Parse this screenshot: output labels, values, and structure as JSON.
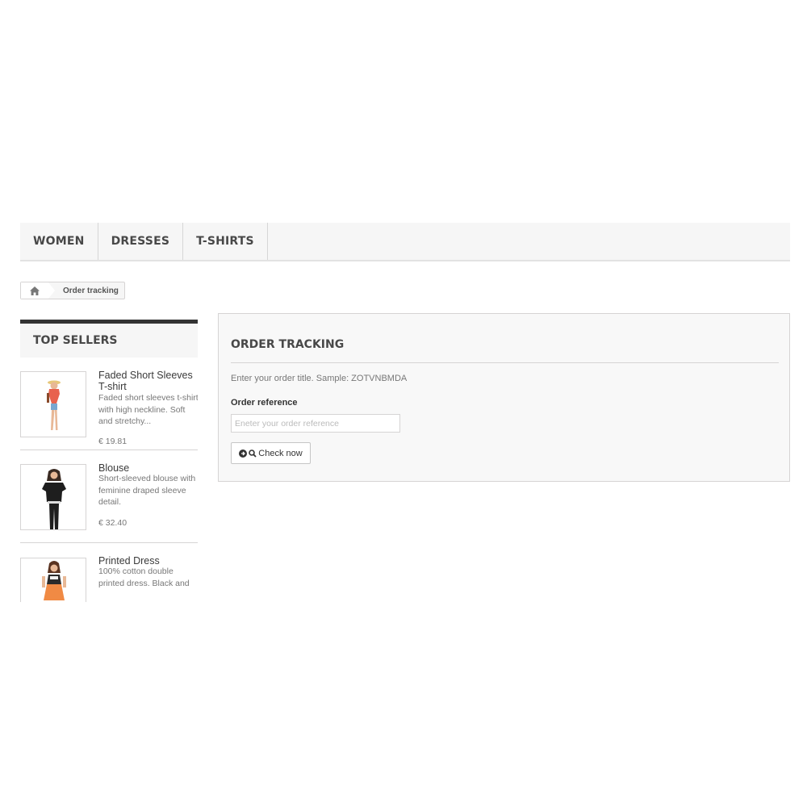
{
  "nav": {
    "items": [
      {
        "label": "WOMEN"
      },
      {
        "label": "DRESSES"
      },
      {
        "label": "T-SHIRTS"
      }
    ]
  },
  "breadcrumb": {
    "home_icon": "home-icon",
    "current": "Order tracking"
  },
  "sidebar": {
    "title": "TOP SELLERS",
    "products": [
      {
        "name": "Faded Short Sleeves T-shirt",
        "description": "Faded short sleeves t-shirt with high neckline. Soft and stretchy...",
        "price": "€ 19.81"
      },
      {
        "name": "Blouse",
        "description": "Short-sleeved blouse with feminine draped sleeve detail.",
        "price": "€ 32.40"
      },
      {
        "name": "Printed Dress",
        "description": "100% cotton double printed dress. Black and"
      }
    ]
  },
  "tracking": {
    "title": "ORDER TRACKING",
    "hint": "Enter your order title. Sample: ZOTVNBMDA",
    "reference_label": "Order reference",
    "reference_placeholder": "Eneter your order reference",
    "reference_value": "",
    "button_label": "Check now",
    "button_icons": [
      "arrow-circle-right-icon",
      "search-icon"
    ]
  },
  "colors": {
    "nav_background": "#f6f6f6",
    "sidebar_title_border": "#333333",
    "panel_background": "#f8f8f8",
    "border": "#d6d4d4"
  }
}
